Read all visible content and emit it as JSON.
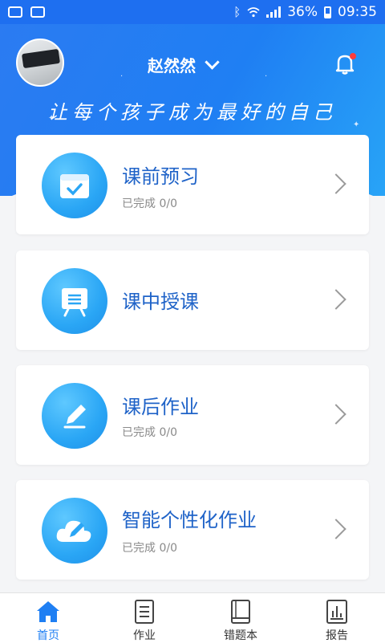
{
  "status_bar": {
    "battery": "36%",
    "time": "09:35",
    "left_icons": [
      "notification-dots-icon",
      "image-icon"
    ],
    "right_icons": [
      "bluetooth-icon",
      "wifi-icon",
      "signal-icon",
      "battery-icon"
    ]
  },
  "header": {
    "username": "赵然然",
    "slogan": "让每个孩子成为最好的自己",
    "accent_color": "#1f7ff3"
  },
  "cards": [
    {
      "title": "课前预习",
      "subtitle": "已完成 0/0",
      "icon": "checkbox-tray-icon"
    },
    {
      "title": "课中授课",
      "subtitle": "",
      "icon": "easel-board-icon"
    },
    {
      "title": "课后作业",
      "subtitle": "已完成 0/0",
      "icon": "pencil-icon"
    },
    {
      "title": "智能个性化作业",
      "subtitle": "已完成 0/0",
      "icon": "cloud-pencil-icon"
    }
  ],
  "bottom_nav": [
    {
      "label": "首页",
      "icon": "home-icon",
      "active": true
    },
    {
      "label": "作业",
      "icon": "document-icon",
      "active": false
    },
    {
      "label": "错题本",
      "icon": "book-icon",
      "active": false
    },
    {
      "label": "报告",
      "icon": "report-chart-icon",
      "active": false
    }
  ]
}
